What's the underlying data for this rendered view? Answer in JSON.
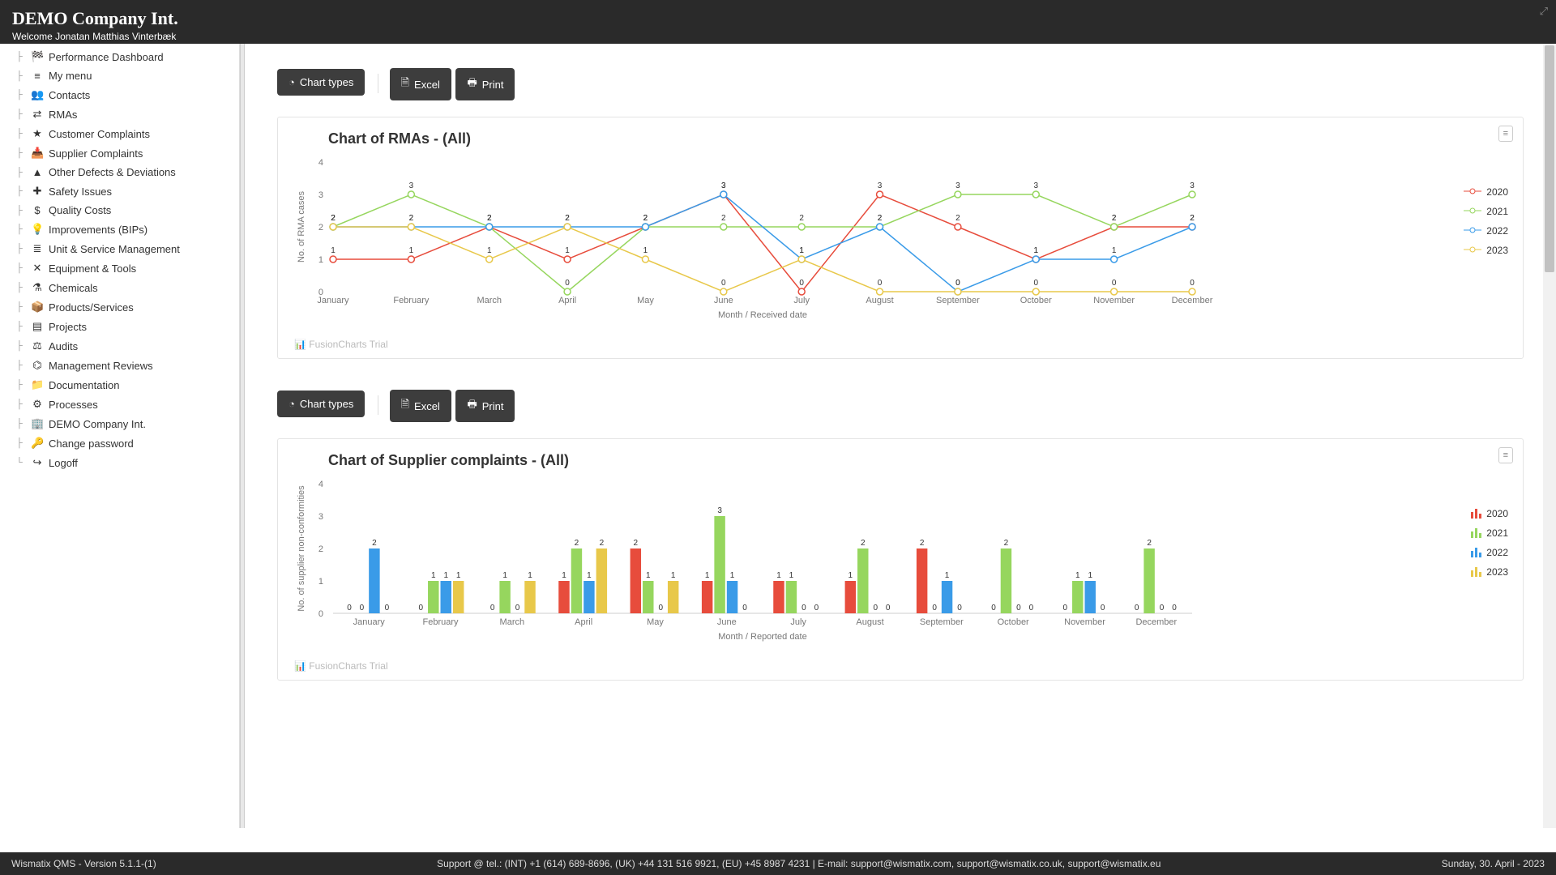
{
  "header": {
    "title": "DEMO Company Int.",
    "welcome": "Welcome Jonatan Matthias Vinterbæk"
  },
  "sidebar": {
    "items": [
      {
        "icon": "dashboard",
        "label": "Performance Dashboard"
      },
      {
        "icon": "menu",
        "label": "My menu"
      },
      {
        "icon": "users",
        "label": "Contacts"
      },
      {
        "icon": "exchange",
        "label": "RMAs"
      },
      {
        "icon": "star",
        "label": "Customer Complaints"
      },
      {
        "icon": "inbox",
        "label": "Supplier Complaints"
      },
      {
        "icon": "warning",
        "label": "Other Defects & Deviations"
      },
      {
        "icon": "medkit",
        "label": "Safety Issues"
      },
      {
        "icon": "dollar",
        "label": "Quality Costs"
      },
      {
        "icon": "bulb",
        "label": "Improvements (BIPs)"
      },
      {
        "icon": "bars",
        "label": "Unit & Service Management"
      },
      {
        "icon": "wrench",
        "label": "Equipment & Tools"
      },
      {
        "icon": "flask",
        "label": "Chemicals"
      },
      {
        "icon": "box",
        "label": "Products/Services"
      },
      {
        "icon": "list",
        "label": "Projects"
      },
      {
        "icon": "gavel",
        "label": "Audits"
      },
      {
        "icon": "sitemap",
        "label": "Management Reviews"
      },
      {
        "icon": "folder",
        "label": "Documentation"
      },
      {
        "icon": "cogs",
        "label": "Processes"
      },
      {
        "icon": "building",
        "label": "DEMO Company Int."
      },
      {
        "icon": "key",
        "label": "Change password"
      },
      {
        "icon": "logout",
        "label": "Logoff"
      }
    ]
  },
  "toolbar": {
    "chart_types": "Chart types",
    "excel": "Excel",
    "print": "Print"
  },
  "chart1_title": "Chart of RMAs - (All)",
  "chart2_title": "Chart of Supplier complaints - (All)",
  "watermark": "FusionCharts Trial",
  "chart_data": [
    {
      "type": "line",
      "title": "Chart of RMAs - (All)",
      "xlabel": "Month / Received date",
      "ylabel": "No. of RMA cases",
      "ylim": [
        0,
        4
      ],
      "categories": [
        "January",
        "February",
        "March",
        "April",
        "May",
        "June",
        "July",
        "August",
        "September",
        "October",
        "November",
        "December"
      ],
      "series": [
        {
          "name": "2020",
          "color": "#e74c3c",
          "values": [
            1,
            1,
            2,
            1,
            2,
            3,
            0,
            3,
            2,
            1,
            2,
            2
          ]
        },
        {
          "name": "2021",
          "color": "#96d65e",
          "values": [
            2,
            3,
            2,
            0,
            2,
            2,
            2,
            2,
            3,
            3,
            2,
            3
          ]
        },
        {
          "name": "2022",
          "color": "#3a9be8",
          "values": [
            2,
            2,
            2,
            2,
            2,
            3,
            1,
            2,
            0,
            1,
            1,
            2
          ]
        },
        {
          "name": "2023",
          "color": "#e8c84a",
          "values": [
            2,
            2,
            1,
            2,
            1,
            0,
            1,
            0,
            0,
            0,
            0,
            0
          ]
        }
      ]
    },
    {
      "type": "bar",
      "title": "Chart of Supplier complaints - (All)",
      "xlabel": "Month / Reported date",
      "ylabel": "No. of supplier non-conformities",
      "ylim": [
        0,
        4
      ],
      "categories": [
        "January",
        "February",
        "March",
        "April",
        "May",
        "June",
        "July",
        "August",
        "September",
        "October",
        "November",
        "December"
      ],
      "series": [
        {
          "name": "2020",
          "color": "#e74c3c",
          "values": [
            0,
            0,
            0,
            1,
            2,
            1,
            1,
            1,
            2,
            0,
            0,
            0
          ]
        },
        {
          "name": "2021",
          "color": "#96d65e",
          "values": [
            0,
            1,
            1,
            2,
            1,
            3,
            1,
            2,
            0,
            2,
            1,
            2
          ]
        },
        {
          "name": "2022",
          "color": "#3a9be8",
          "values": [
            2,
            1,
            0,
            1,
            0,
            1,
            0,
            0,
            1,
            0,
            1,
            0
          ]
        },
        {
          "name": "2023",
          "color": "#e8c84a",
          "values": [
            0,
            1,
            1,
            2,
            1,
            0,
            0,
            0,
            0,
            0,
            0,
            0
          ]
        }
      ]
    }
  ],
  "footer": {
    "left": "Wismatix QMS - Version 5.1.1-(1)",
    "center": "Support @ tel.: (INT) +1 (614) 689-8696, (UK) +44 131 516 9921, (EU) +45 8987 4231 | E-mail: support@wismatix.com, support@wismatix.co.uk, support@wismatix.eu",
    "right": "Sunday, 30. April - 2023"
  },
  "legend_years": [
    "2020",
    "2021",
    "2022",
    "2023"
  ],
  "legend_colors": {
    "2020": "#e74c3c",
    "2021": "#96d65e",
    "2022": "#3a9be8",
    "2023": "#e8c84a"
  }
}
